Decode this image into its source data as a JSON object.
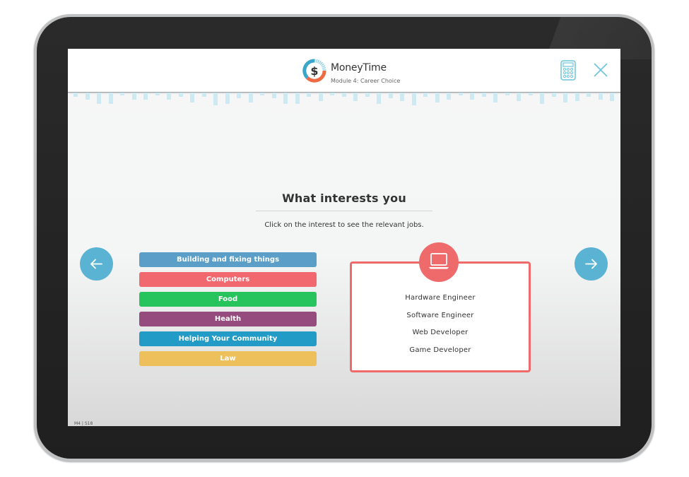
{
  "header": {
    "brand": "MoneyTime",
    "module": "Module 4: Career Choice",
    "icons": {
      "logo": "dollar-circle-logo-icon",
      "calculator": "calculator-icon",
      "close": "close-icon"
    }
  },
  "main": {
    "title": "What interests you",
    "subtitle": "Click on the interest to see the relevant jobs.",
    "nav": {
      "prev": "arrow-left-icon",
      "next": "arrow-right-icon"
    },
    "interests": [
      {
        "label": "Building and fixing things",
        "color": "#5b9fc9"
      },
      {
        "label": "Computers",
        "color": "#f2686f"
      },
      {
        "label": "Food",
        "color": "#27c45e"
      },
      {
        "label": "Health",
        "color": "#954b7d"
      },
      {
        "label": "Helping Your Community",
        "color": "#229bc6"
      },
      {
        "label": "Law",
        "color": "#eec05b"
      }
    ],
    "selected_interest": "Computers",
    "jobs_panel": {
      "icon": "laptop-icon",
      "accent": "#ef6b6b",
      "jobs": [
        "Hardware Engineer",
        "Software Engineer",
        "Web Developer",
        "Game Developer"
      ]
    }
  },
  "footer": {
    "code": "M4 | S18"
  },
  "colors": {
    "nav_button": "#5bb3d3",
    "icon_stroke": "#6cc5dc"
  }
}
